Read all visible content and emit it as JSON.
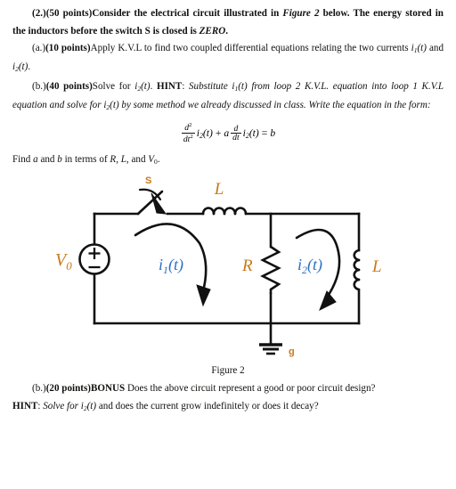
{
  "document": {
    "problem_number": "(2.)",
    "problem_points": "(50 points)",
    "intro_line1": "Consider the electrical circuit illustrated in ",
    "intro_figure_ref": "Figure 2",
    "intro_line1_tail": " below. The",
    "intro_line2": "energy stored in the inductors before the switch S is closed is ",
    "intro_zero": "ZERO",
    "intro_period": ".",
    "part_a_label": "(a.)",
    "part_a_points": "(10 points)",
    "part_a_text": "Apply K.V.L to find two coupled differential equations relating the two",
    "part_a_text2_pre": "currents ",
    "part_a_i1": "i",
    "part_a_i1_sub": "1",
    "part_a_i1_arg": "(t)",
    "part_a_and": " and ",
    "part_a_i2": "i",
    "part_a_i2_sub": "2",
    "part_a_i2_arg": "(t)",
    "part_a_period": ".",
    "part_b_label": "(b.)",
    "part_b_points": "(40 points)",
    "part_b_solve": "Solve for ",
    "part_b_i2": "i",
    "part_b_i2_sub": "2",
    "part_b_i2_arg": "(t)",
    "part_b_dot": ". ",
    "part_b_hint_label": "HINT",
    "part_b_hint_colon": ": ",
    "part_b_hint_1": "Substitute ",
    "part_b_hint_i1": "i",
    "part_b_hint_i1_sub": "1",
    "part_b_hint_i1_arg": "(t)",
    "part_b_hint_2": " from loop 2 K.V.L. equation into",
    "part_b_hint_3": "loop 1 K.V.L equation and solve for ",
    "part_b_hint_i2": "i",
    "part_b_hint_i2_sub": "2",
    "part_b_hint_i2_arg": "(t)",
    "part_b_hint_4": " by some method we already discussed in class.  Write",
    "part_b_hint_5": "the equation in the form:",
    "equation": {
      "frac1_num": "d",
      "frac1_num_sup": "2",
      "frac1_den": "dt",
      "frac1_den_sup": "2",
      "term1": "i",
      "term1_sub": "2",
      "term1_arg": "(t)",
      "plus": "+",
      "coeff_a": "a",
      "frac2_num": "d",
      "frac2_den": "dt",
      "term2": "i",
      "term2_sub": "2",
      "term2_arg": "(t)",
      "equals": "=",
      "rhs": "b"
    },
    "find_line_pre": "Find ",
    "find_a": "a",
    "find_and": " and ",
    "find_b": "b",
    "find_mid": " in terms of ",
    "find_R": "R",
    "find_comma1": ", ",
    "find_L": "L",
    "find_comma2": ", and ",
    "find_V": "V",
    "find_V_sub": "0",
    "find_period": ".",
    "figure_caption": "Figure 2",
    "bonus_label": "(b.)",
    "bonus_points": "(20 points)",
    "bonus_word": "BONUS",
    "bonus_text": " Does the above circuit represent a good or poor circuit design?",
    "bonus_hint_label": "HINT",
    "bonus_hint_colon": ": ",
    "bonus_hint_pre": "Solve for ",
    "bonus_hint_i2": "i",
    "bonus_hint_i2_sub": "2",
    "bonus_hint_i2_arg": "(t)",
    "bonus_hint_post": " and does the current grow indefinitely or does it decay?"
  },
  "circuit": {
    "label_switch": "S",
    "label_source": "V",
    "label_source_sub": "0",
    "label_source_plus": "+",
    "label_source_minus": "−",
    "label_inductor_top": "L",
    "label_resistor": "R",
    "label_inductor_right": "L",
    "label_current1": "i",
    "label_current1_sub": "1",
    "label_current1_arg": "(t)",
    "label_current2": "i",
    "label_current2_sub": "2",
    "label_current2_arg": "(t)",
    "label_ground": "g"
  },
  "colors": {
    "wire": "#111111",
    "text": "#12100e",
    "label_component": "#c8791a",
    "label_current": "#2a6ec4",
    "background": "#ffffff"
  }
}
